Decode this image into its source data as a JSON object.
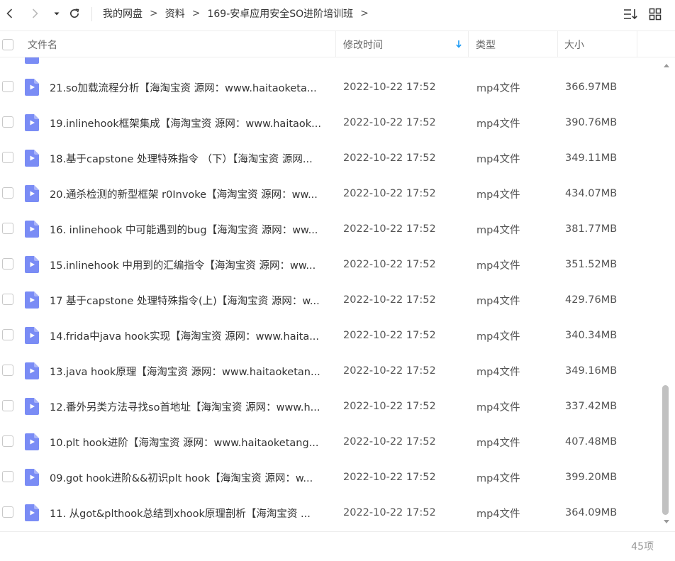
{
  "breadcrumb": {
    "items": [
      "我的网盘",
      "资料",
      "169-安卓应用安全SO进阶培训班"
    ],
    "separator": ">"
  },
  "icons": {
    "back": "chevron-left-icon",
    "forward": "chevron-right-icon",
    "history": "caret-down-icon",
    "refresh": "refresh-icon",
    "sort": "sort-list-icon",
    "view": "grid-view-icon",
    "file": "video-file-icon"
  },
  "colors": {
    "accent": "#1a9af5",
    "file_icon": "#7a8cf5",
    "scroll_thumb": "#c1c1c1"
  },
  "header": {
    "name": "文件名",
    "modified": "修改时间",
    "type": "类型",
    "size": "大小"
  },
  "rows": [
    {
      "name": "21.so加载流程分析【海淘宝资 源网：www.haitaoketa...",
      "date": "2022-10-22 17:52",
      "type": "mp4文件",
      "size": "366.97MB"
    },
    {
      "name": "19.inlinehook框架集成【海淘宝资 源网：www.haitaok...",
      "date": "2022-10-22 17:52",
      "type": "mp4文件",
      "size": "390.76MB"
    },
    {
      "name": "18.基于capstone 处理特殊指令 （下）【海淘宝资 源网...",
      "date": "2022-10-22 17:52",
      "type": "mp4文件",
      "size": "349.11MB"
    },
    {
      "name": "20.通杀检测的新型框架 r0Invoke【海淘宝资 源网：ww...",
      "date": "2022-10-22 17:52",
      "type": "mp4文件",
      "size": "434.07MB"
    },
    {
      "name": "16. inlinehook 中可能遇到的bug【海淘宝资 源网：ww...",
      "date": "2022-10-22 17:52",
      "type": "mp4文件",
      "size": "381.77MB"
    },
    {
      "name": "15.inlinehook 中用到的汇编指令【海淘宝资 源网：ww...",
      "date": "2022-10-22 17:52",
      "type": "mp4文件",
      "size": "351.52MB"
    },
    {
      "name": "17 基于capstone 处理特殊指令(上)【海淘宝资 源网：w...",
      "date": "2022-10-22 17:52",
      "type": "mp4文件",
      "size": "429.76MB"
    },
    {
      "name": "14.frida中java hook实现【海淘宝资 源网：www.haita...",
      "date": "2022-10-22 17:52",
      "type": "mp4文件",
      "size": "340.34MB"
    },
    {
      "name": "13.java hook原理【海淘宝资 源网：www.haitaoketan...",
      "date": "2022-10-22 17:52",
      "type": "mp4文件",
      "size": "349.16MB"
    },
    {
      "name": "12.番外另类方法寻找so首地址【海淘宝资 源网：www.h...",
      "date": "2022-10-22 17:52",
      "type": "mp4文件",
      "size": "337.42MB"
    },
    {
      "name": "10.plt hook进阶【海淘宝资 源网：www.haitaoketang...",
      "date": "2022-10-22 17:52",
      "type": "mp4文件",
      "size": "407.48MB"
    },
    {
      "name": "09.got hook进阶&&初识plt hook【海淘宝资 源网：w...",
      "date": "2022-10-22 17:52",
      "type": "mp4文件",
      "size": "399.20MB"
    },
    {
      "name": "11. 从got&plthook总结到xhook原理剖析【海淘宝资 ...",
      "date": "2022-10-22 17:52",
      "type": "mp4文件",
      "size": "364.09MB"
    }
  ],
  "footer": {
    "count": "45项"
  }
}
